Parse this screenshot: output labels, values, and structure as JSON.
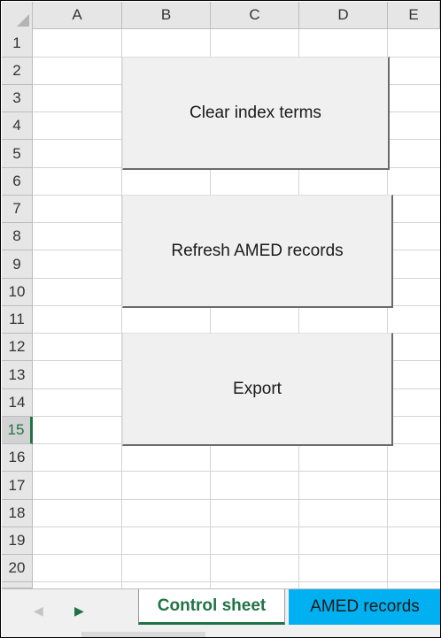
{
  "columns": [
    "A",
    "B",
    "C",
    "D",
    "E"
  ],
  "rows": [
    "1",
    "2",
    "3",
    "4",
    "5",
    "6",
    "7",
    "8",
    "9",
    "10",
    "11",
    "12",
    "13",
    "14",
    "15",
    "16",
    "17",
    "18",
    "19",
    "20"
  ],
  "active_row": "15",
  "buttons": {
    "clear": "Clear index terms",
    "refresh": "Refresh AMED records",
    "export": "Export"
  },
  "sheet_tabs": {
    "control": "Control sheet",
    "amed": "AMED records"
  },
  "icons": {
    "nav_left": "triangle-left-icon",
    "nav_right": "triangle-right-icon",
    "select_all": "select-all-triangle-icon"
  },
  "colors": {
    "excel_green": "#217346",
    "amed_tab": "#00b0f0"
  }
}
